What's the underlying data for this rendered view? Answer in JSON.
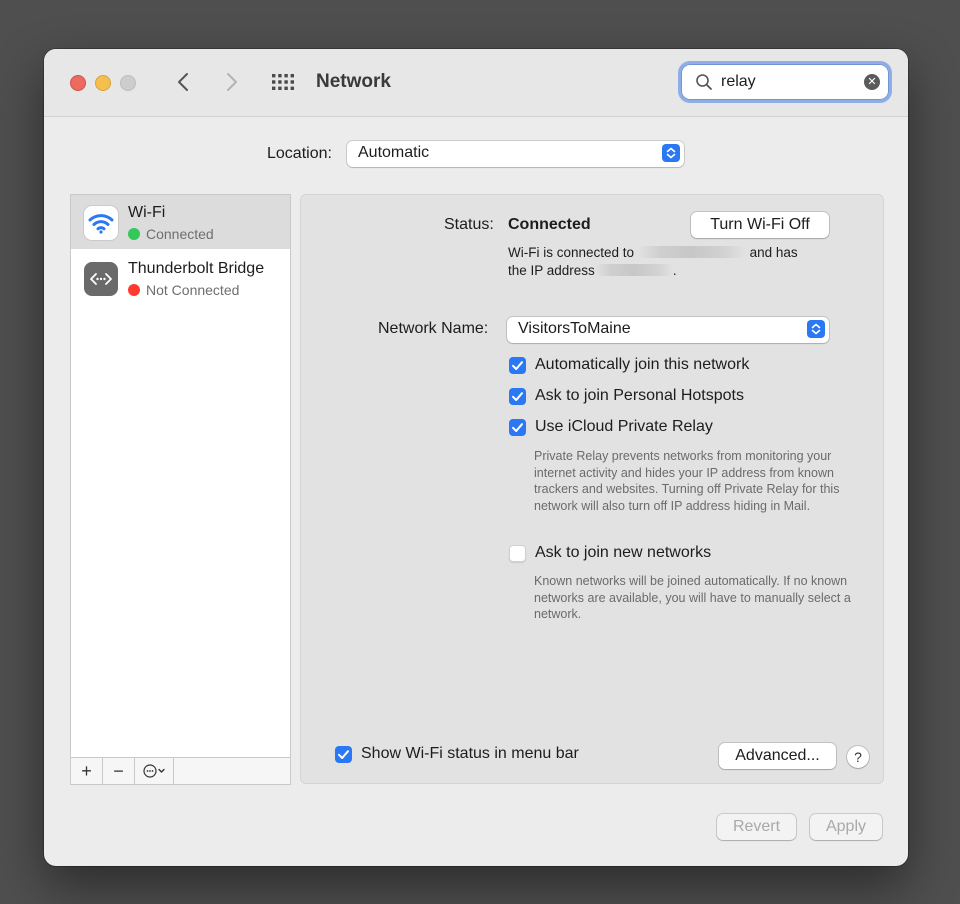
{
  "window": {
    "title": "Network"
  },
  "search": {
    "value": "relay"
  },
  "location": {
    "label": "Location:",
    "value": "Automatic"
  },
  "sidebar": {
    "items": [
      {
        "name": "Wi-Fi",
        "status": "Connected",
        "status_color": "#34c759",
        "icon": "wifi-icon",
        "selected": true
      },
      {
        "name": "Thunderbolt Bridge",
        "status": "Not Connected",
        "status_color": "#ff3b30",
        "icon": "thunderbolt-bridge-icon",
        "selected": false
      }
    ],
    "toolbar": {
      "add": "+",
      "remove": "−"
    }
  },
  "panel": {
    "status_label": "Status:",
    "status_value": "Connected",
    "turn_off_label": "Turn Wi-Fi Off",
    "status_desc": {
      "part1": "Wi-Fi is connected to",
      "part2": "and has",
      "part3": "the IP address",
      "part4": "."
    },
    "network_name_label": "Network Name:",
    "network_name_value": "VisitorsToMaine",
    "options": [
      {
        "label": "Automatically join this network",
        "checked": true
      },
      {
        "label": "Ask to join Personal Hotspots",
        "checked": true
      },
      {
        "label": "Use iCloud Private Relay",
        "checked": true
      },
      {
        "label": "Ask to join new networks",
        "checked": false
      }
    ],
    "private_relay_help": "Private Relay prevents networks from monitoring your internet activity and hides your IP address from known trackers and websites. Turning off Private Relay for this network will also turn off IP address hiding in Mail.",
    "new_networks_help": "Known networks will be joined automatically. If no known networks are available, you will have to manually select a network.",
    "show_menubar_label": "Show Wi-Fi status in menu bar",
    "show_menubar_checked": true,
    "advanced_label": "Advanced...",
    "help_label": "?"
  },
  "footer": {
    "revert_label": "Revert",
    "apply_label": "Apply"
  },
  "colors": {
    "accent": "#2b78f5",
    "search_focus": "#8eaee5"
  }
}
